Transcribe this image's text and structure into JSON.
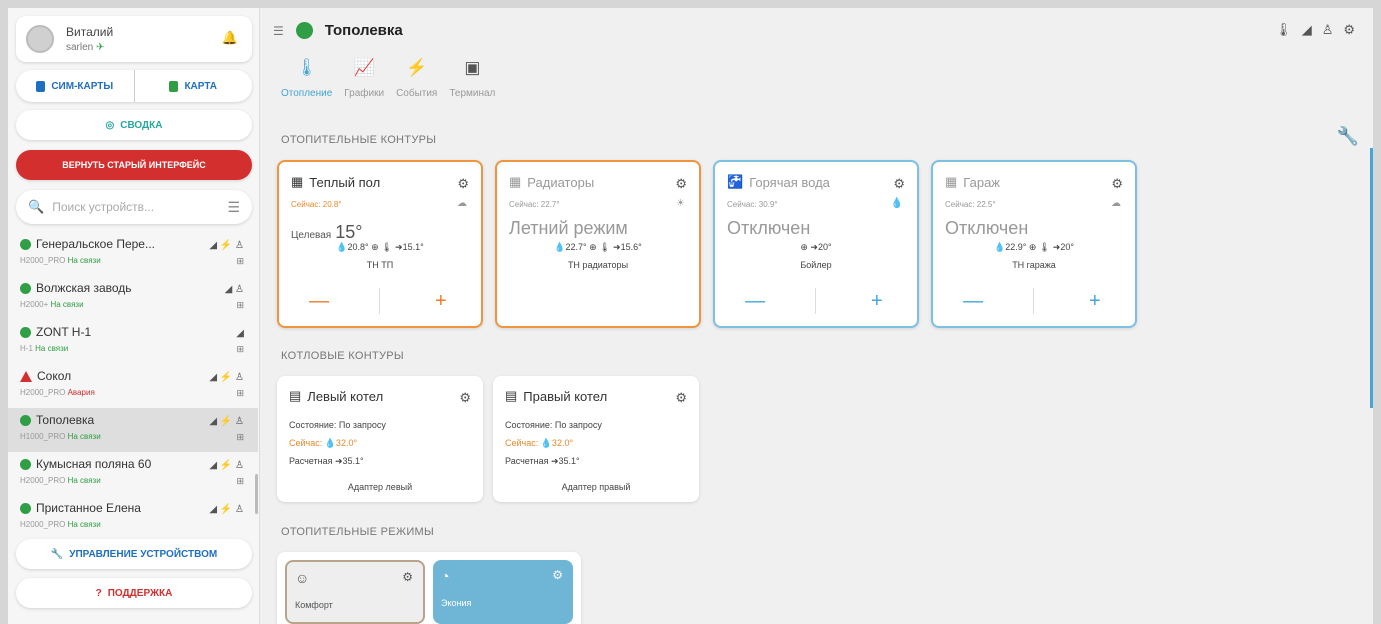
{
  "user": {
    "name": "Виталий",
    "login": "sarlen",
    "login_icon": "✈"
  },
  "buttons": {
    "sim": "СИМ-КАРТЫ",
    "map": "КАРТА",
    "summary": "СВОДКА",
    "old_ui": "ВЕРНУТЬ СТАРЫЙ ИНТЕРФЕЙС",
    "manage": "УПРАВЛЕНИЕ УСТРОЙСТВОМ",
    "support": "ПОДДЕРЖКА"
  },
  "search": {
    "placeholder": "Поиск устройств..."
  },
  "devices": [
    {
      "name": "Генеральское Пере...",
      "model": "H2000_PRO",
      "status": "На связи",
      "signal": "◢ ⚡ ♙"
    },
    {
      "name": "Волжская заводь",
      "model": "H2000+",
      "status": "На связи",
      "signal": "◢ ♙"
    },
    {
      "name": "ZONT H-1",
      "model": "H-1",
      "status": "На связи",
      "signal": "◢"
    },
    {
      "name": "Сокол",
      "model": "H2000_PRO",
      "status": "Авария",
      "signal": "◢ ⚡ ♙"
    },
    {
      "name": "Тополевка",
      "model": "H1000_PRO",
      "status": "На связи",
      "signal": "◢ ⚡ ♙"
    },
    {
      "name": "Кумысная поляна 60",
      "model": "H2000_PRO",
      "status": "На связи",
      "signal": "◢ ⚡ ♙"
    },
    {
      "name": "Пристанное Елена",
      "model": "H2000_PRO",
      "status": "На связи",
      "signal": "◢ ⚡ ♙"
    }
  ],
  "header": {
    "title": "Тополевка"
  },
  "tabs": [
    {
      "label": "Отопление",
      "icon": "thermometer-icon"
    },
    {
      "label": "Графики",
      "icon": "chart-icon"
    },
    {
      "label": "События",
      "icon": "lightning-icon"
    },
    {
      "label": "Терминал",
      "icon": "terminal-icon"
    }
  ],
  "sections": {
    "heating_circuits": "ОТОПИТЕЛЬНЫЕ КОНТУРЫ",
    "boiler_circuits": "КОТЛОВЫЕ КОНТУРЫ",
    "heating_modes": "ОТОПИТЕЛЬНЫЕ РЕЖИМЫ"
  },
  "circuits": [
    {
      "title": "Теплый пол",
      "now": "Сейчас: 20.8°",
      "target_label": "Целевая",
      "target": "15°",
      "info": "💧20.8° ⊕ 🌡 ➜15.1°",
      "sensor": "TH ТП"
    },
    {
      "title": "Радиаторы",
      "now": "Сейчас: 22.7°",
      "mode": "Летний режим",
      "info": "💧22.7° ⊕ 🌡 ➜15.6°",
      "sensor": "TH радиаторы"
    },
    {
      "title": "Горячая вода",
      "now": "Сейчас: 30.9°",
      "mode": "Отключен",
      "info": "⊕ ➜20°",
      "sensor": "Бойлер"
    },
    {
      "title": "Гараж",
      "now": "Сейчас: 22.5°",
      "mode": "Отключен",
      "info": "💧22.9° ⊕ 🌡 ➜20°",
      "sensor": "TH гаража"
    }
  ],
  "boilers": [
    {
      "title": "Левый котел",
      "state": "Состояние: По запросу",
      "now": "Сейчас: 💧32.0°",
      "calc": "Расчетная ➜35.1°",
      "adapter": "Адаптер левый"
    },
    {
      "title": "Правый котел",
      "state": "Состояние: По запросу",
      "now": "Сейчас: 💧32.0°",
      "calc": "Расчетная ➜35.1°",
      "adapter": "Адаптер правый"
    }
  ],
  "modes": [
    {
      "label": "Комфорт"
    },
    {
      "label": "Экония"
    }
  ],
  "colors": {
    "accent": "#43a5d9",
    "ok": "#2f9e44",
    "alarm": "#d32f2f",
    "orange": "#f0953f"
  }
}
